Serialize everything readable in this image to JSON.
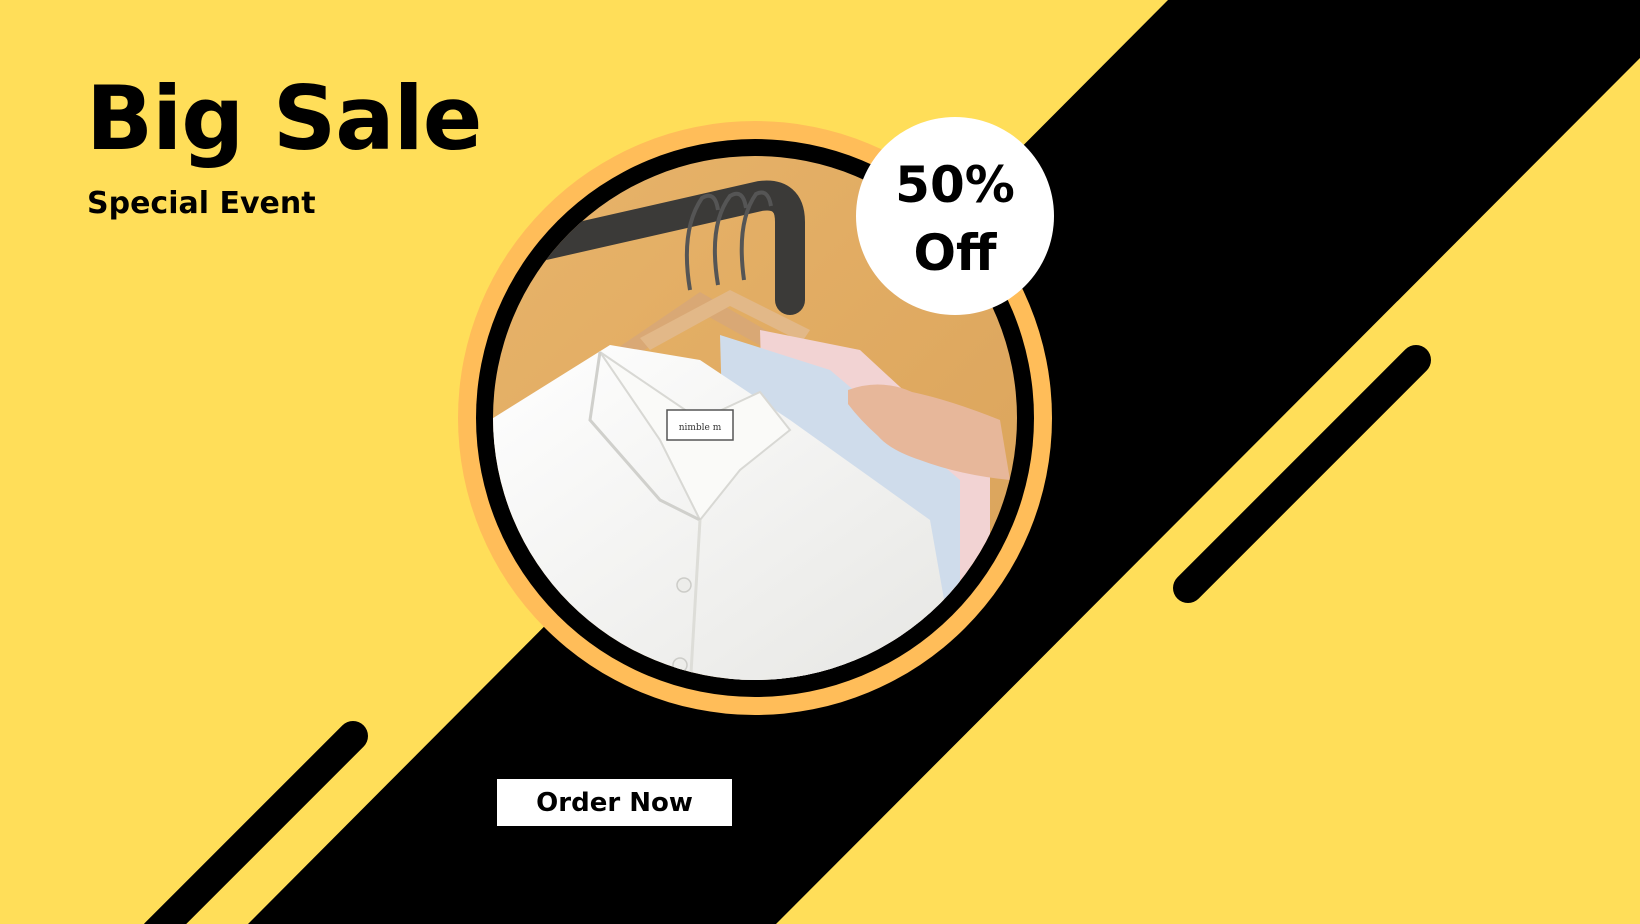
{
  "banner": {
    "title": "Big Sale",
    "subtitle": "Special Event",
    "badge": {
      "line1": "50%",
      "line2": "Off"
    },
    "cta_label": "Order Now",
    "photo_label": "nimble m",
    "colors": {
      "background": "#FFDE59",
      "band": "#000000",
      "ring": "#FFBD59",
      "badge": "#FFFFFF",
      "text": "#000000"
    }
  }
}
